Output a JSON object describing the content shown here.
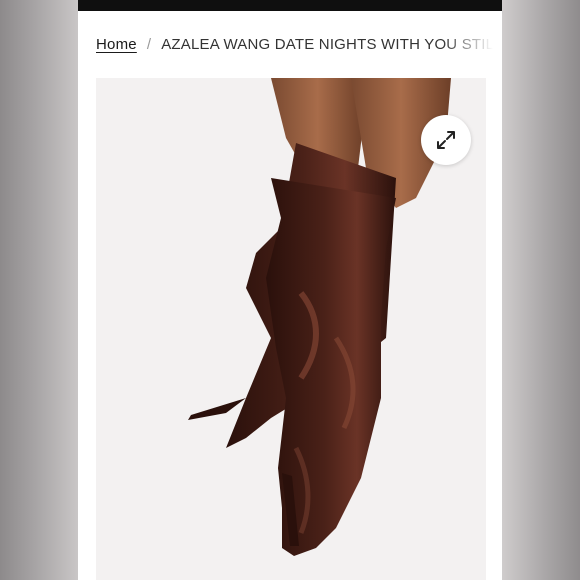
{
  "breadcrumb": {
    "home": "Home",
    "separator": "/",
    "current": "AZALEA WANG DATE NIGHTS WITH YOU STILETTO BOOT"
  },
  "gallery": {
    "expand_icon": "expand-arrows-icon",
    "boot_color": "#3b1a12"
  }
}
